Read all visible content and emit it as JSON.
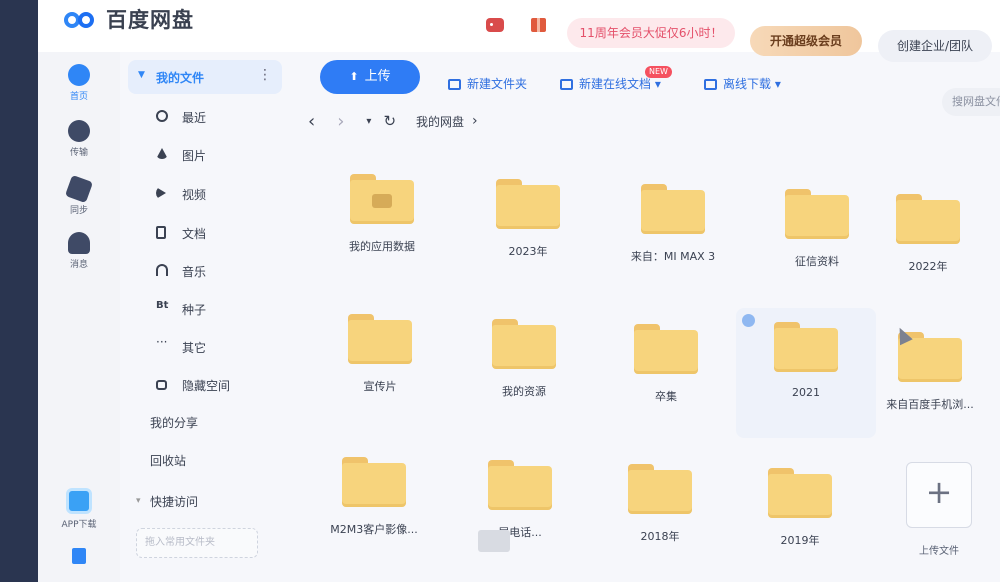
{
  "app": {
    "name": "百度网盘"
  },
  "header": {
    "promo": "11周年会员大促仅6小时！",
    "vip_button": "开通超级会员",
    "team_button": "创建企业/团队"
  },
  "rail": {
    "home": "首页",
    "transfer": "传输",
    "sync": "同步",
    "messages": "消息",
    "app_download": "APP下载"
  },
  "sidenav": {
    "my_files": "我的文件",
    "items": [
      "最近",
      "图片",
      "视频",
      "文档",
      "音乐",
      "种子",
      "其它",
      "隐藏空间"
    ],
    "my_share": "我的分享",
    "recycle": "回收站",
    "quick_access": "快捷访问",
    "quick_add": "拖入常用文件夹"
  },
  "toolbar": {
    "upload": "上传",
    "new_folder": "新建文件夹",
    "new_online_doc": "新建在线文档",
    "new_badge": "NEW",
    "offline_download": "离线下载",
    "search_placeholder": "搜网盘文件"
  },
  "breadcrumb": {
    "current": "我的网盘"
  },
  "folders": [
    "我的应用数据",
    "2023年",
    "来自：MI MAX 3",
    "征信资料",
    "2022年",
    "宣传片",
    "我的资源",
    "卒集",
    "2021",
    "来自百度手机浏...",
    "M2M3客户影像...",
    "屋电话...",
    "2018年",
    "2019年"
  ],
  "upload_tile": {
    "label": "上传文件"
  },
  "colors": {
    "accent": "#2f7cf5",
    "folder": "#f7d47d"
  }
}
